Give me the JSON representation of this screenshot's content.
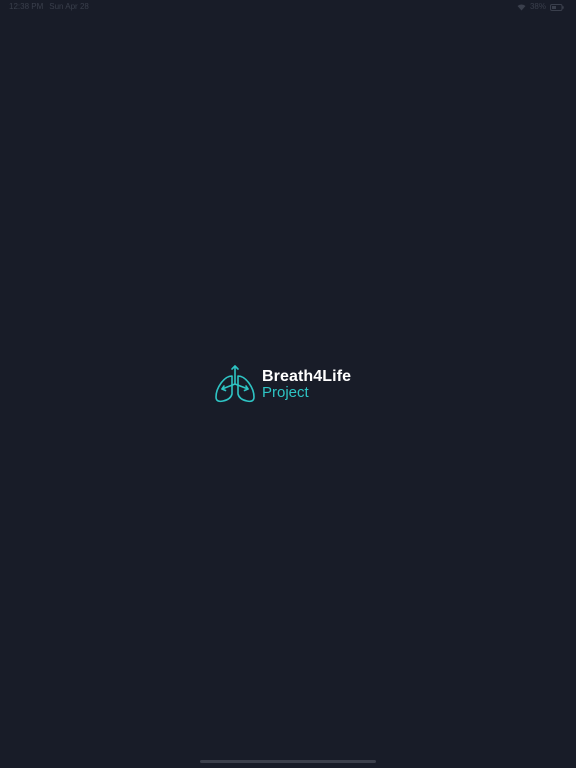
{
  "status_bar": {
    "time": "12:38 PM",
    "date": "Sun Apr 28",
    "battery_percent": "38%",
    "wifi_icon": "wifi-icon",
    "battery_icon": "battery-icon"
  },
  "logo": {
    "icon": "lungs-icon",
    "title": "Breath4Life",
    "subtitle": "Project",
    "accent_color": "#2ec4c4"
  },
  "colors": {
    "background": "#181c28",
    "title_text": "#ffffff"
  }
}
